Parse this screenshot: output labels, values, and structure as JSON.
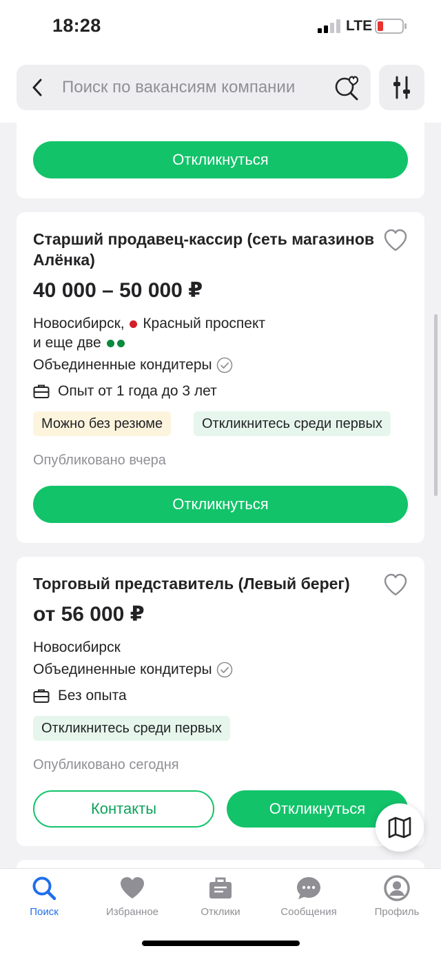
{
  "status_bar": {
    "time": "18:28",
    "network": "LTE"
  },
  "search": {
    "placeholder": "Поиск по вакансиям компании"
  },
  "colors": {
    "accent": "#12c36a",
    "tab_active": "#1f6feb",
    "metro_red": "#d21f2a",
    "metro_green": "#0a8a3c"
  },
  "cards": [
    {
      "respond_label": "Откликнуться"
    },
    {
      "title": "Старший продавец-кассир (сеть магазинов Алёнка)",
      "salary": "40 000 – 50 000 ₽",
      "city": "Новосибирск,",
      "metro": "Красный проспект",
      "metro_more": "и еще две",
      "company": "Объединенные кондитеры",
      "experience": "Опыт от 1 года до 3 лет",
      "tags": [
        "Можно без резюме",
        "Откликнитесь среди первых"
      ],
      "published": "Опубликовано вчера",
      "respond_label": "Откликнуться"
    },
    {
      "title": "Торговый представитель (Левый берег)",
      "salary": "от 56 000 ₽",
      "city": "Новосибирск",
      "company": "Объединенные кондитеры",
      "experience": "Без опыта",
      "tags": [
        "Откликнитесь среди первых"
      ],
      "published": "Опубликовано сегодня",
      "contacts_label": "Контакты",
      "respond_label": "Откликнуться"
    }
  ],
  "tabbar": {
    "items": [
      {
        "label": "Поиск",
        "icon": "search-icon",
        "active": true
      },
      {
        "label": "Избранное",
        "icon": "heart-icon"
      },
      {
        "label": "Отклики",
        "icon": "responses-icon"
      },
      {
        "label": "Сообщения",
        "icon": "chat-icon"
      },
      {
        "label": "Профиль",
        "icon": "profile-icon"
      }
    ]
  }
}
